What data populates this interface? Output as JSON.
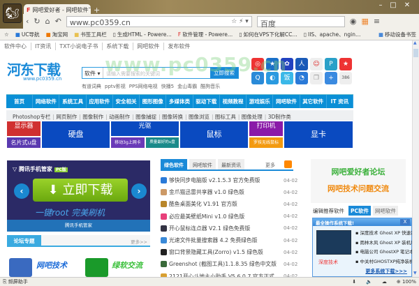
{
  "browser": {
    "tab_title": "网吧爱好者 - 网吧软件下",
    "url": "www.pc0359.cn",
    "search_placeholder": "百度",
    "bookmarks": [
      "UC导航",
      "淘宝网",
      "书签工具栏",
      "生成HTML - Powere…",
      "软件管理 - Powere…",
      "如何在VPS下化解CC…",
      "IIS、apache、ngin…"
    ],
    "mobile_bookmarks": "移动设备书签"
  },
  "site": {
    "topnav": [
      "软件中心",
      "IT资讯",
      "TXT小说电子书",
      "系统下载",
      "网吧软件",
      "发布软件"
    ],
    "logo": "河东下载",
    "logo_url": "www.pc0359.cn",
    "watermark": "www.pc0359.cn",
    "search": {
      "category": "软件",
      "placeholder": "请输入需要搜索的关键词",
      "button": "立即搜索"
    },
    "hotwords": [
      "有道词典",
      "pptv影视",
      "PPS网络电视",
      "快播5",
      "金山毒霸",
      "酷狗音乐"
    ],
    "icon_count": "386",
    "mainnav": [
      "首页",
      "网络软件",
      "系统工具",
      "应用软件",
      "安全相关",
      "图形图像",
      "多媒体类",
      "驱动下载",
      "视频教程",
      "游戏娱乐",
      "网吧软件",
      "其它软件",
      "IT 资讯"
    ],
    "subnav": [
      "Photoshop专栏",
      "网页制作",
      "图像制作",
      "动画制作",
      "图像捕捉",
      "图像转换",
      "图像浏览",
      "图标工具",
      "图像处理",
      "3D制作类"
    ],
    "tiles": [
      "显示器",
      "名片式u盘",
      "硬盘",
      "光驱",
      "移动3g上网卡",
      "质量最好的u盘",
      "鼠标",
      "打印机",
      "罗技无线鼠标",
      "显卡"
    ],
    "banner": {
      "title": "腾讯手机管家",
      "badge": "PC版",
      "button": "立即下载",
      "slogan": "一键root  完美刷机",
      "footer": "腾讯手机管家"
    },
    "forum": {
      "title": "论坛专题",
      "more": "更多>>",
      "items": [
        "网吧技术",
        "绿软交流"
      ]
    },
    "mid": {
      "tabs": [
        "绿色软件",
        "网吧软件",
        "最新资讯"
      ],
      "more": "更多",
      "items": [
        {
          "title": "够快同步电脑版 v2.1.5.3 官方免费版",
          "date": "04-02",
          "color": "#2a7ad8"
        },
        {
          "title": "金爪猫迅雷共享器 v1.0 绿色版",
          "date": "04-02",
          "color": "#c96"
        },
        {
          "title": "酷鱼桌面美化 V1.91 官方版",
          "date": "04-02",
          "color": "#b8862a"
        },
        {
          "title": "必应最美壁纸Mini v1.0 绿色版",
          "date": "04-02",
          "color": "#e8407a"
        },
        {
          "title": "开心鼠标连点器 V2.1 绿色免费版",
          "date": "04-02",
          "color": "#334"
        },
        {
          "title": "光速文件批量搜索器 4.2 免费绿色版",
          "date": "04-02",
          "color": "#3a8ad8"
        },
        {
          "title": "窗口背景隐藏工具(Zorro) v1.5 绿色版",
          "date": "04-02",
          "color": "#222"
        },
        {
          "title": "Greenshot (截图工具)1.1.8.35 绿色中文版",
          "date": "04-02",
          "color": "#3a6a3a"
        },
        {
          "title": "2121开心斗地主小助手 V5.6.0.7 官方正式",
          "date": "04-02",
          "color": "#d9a030"
        }
      ]
    },
    "forum_ad": [
      "网吧爱好者论坛",
      "网吧技术问题交流"
    ],
    "right_tabs": [
      "编辑推荐软件",
      "PC软件",
      "网吧软件"
    ],
    "popup": {
      "title": "最全操作系统下载!",
      "close": "X",
      "image_caption": "深度技术",
      "items": [
        "深度技术 Ghost XP 快速装",
        "雨林木风 Ghost XP 装机版",
        "电脑公司 GhostXP 笔记本",
        "中关村GHOSTXP纯净装机"
      ],
      "more": "更多系统下载>>>"
    }
  },
  "status": {
    "left": "频屏助手",
    "zoom": "100%"
  }
}
